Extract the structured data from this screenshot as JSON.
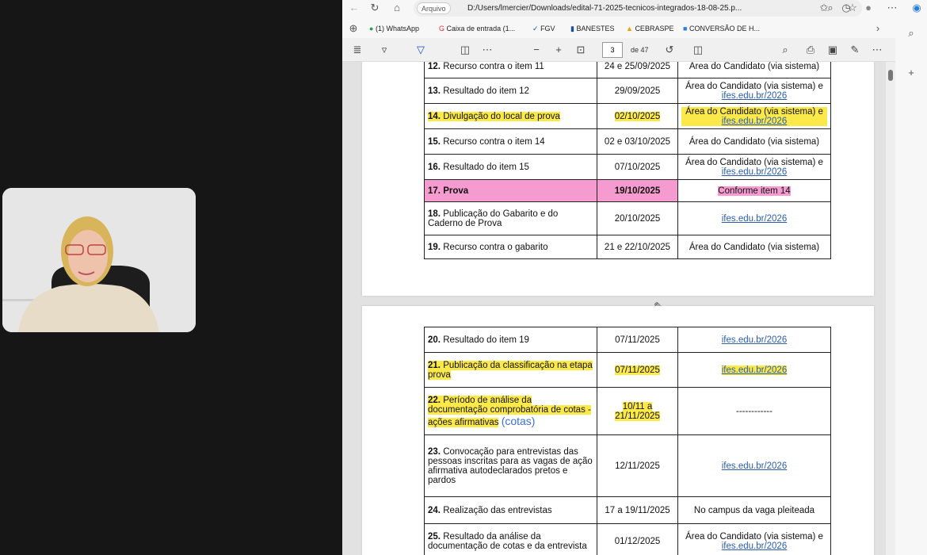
{
  "browser": {
    "address_chip": "Arquivo",
    "url": "D:/Users/lmercier/Downloads/edital-71-2025-tecnicos-integrados-18-08-25.p...",
    "bookmarks": [
      "(1) WhatsApp",
      "Caixa de entrada (1...",
      "FGV",
      "BANESTES",
      "CEBRASPE",
      "CONVERSÃO DE H..."
    ]
  },
  "pdf_toolbar": {
    "page_number": "3",
    "page_total": "de 47"
  },
  "colors": {
    "highlight_yellow": "#fbe94a",
    "highlight_pink": "#f59bd0",
    "link": "#2a5db0"
  },
  "page1_rows": [
    {
      "num": "12.",
      "item": "Recurso contra o item 11",
      "date": "24 e 25/09/2025",
      "where": "Área do Candidato (via sistema)"
    },
    {
      "num": "13.",
      "item": "Resultado do item 12",
      "date": "29/09/2025",
      "where": "Área do Candidato (via sistema) e",
      "link": "ifes.edu.br/2026"
    },
    {
      "num": "14.",
      "item": "Divulgação do local de prova",
      "date": "02/10/2025",
      "where": "Área do Candidato (via sistema) e",
      "link": "ifes.edu.br/2026"
    },
    {
      "num": "15.",
      "item": "Recurso contra o item 14",
      "date": "02 e 03/10/2025",
      "where": "Área do Candidato (via sistema)"
    },
    {
      "num": "16.",
      "item": "Resultado do item 15",
      "date": "07/10/2025",
      "where": "Área do Candidato (via sistema) e",
      "link": "ifes.edu.br/2026"
    },
    {
      "num": "17.",
      "item": "Prova",
      "date": "19/10/2025",
      "where": "Conforme item 14"
    },
    {
      "num": "18.",
      "item": "Publicação do Gabarito e do Caderno de Prova",
      "date": "20/10/2025",
      "link": "ifes.edu.br/2026"
    },
    {
      "num": "19.",
      "item": "Recurso contra o gabarito",
      "date": "21 e 22/10/2025",
      "where": "Área do Candidato (via sistema)"
    }
  ],
  "page2_rows": [
    {
      "num": "20.",
      "item": "Resultado do item 19",
      "date": "07/11/2025",
      "link": "ifes.edu.br/2026"
    },
    {
      "num": "21.",
      "item": "Publicação da classificação na etapa prova",
      "date": "07/11/2025",
      "link": "ifes.edu.br/2026"
    },
    {
      "num": "22.",
      "item": "Período de análise da documentação comprobatória de cotas - ações afirmativas",
      "annotation": "(cotas)",
      "date": "10/11 a 21/11/2025",
      "where": "------------"
    },
    {
      "num": "23.",
      "item": "Convocação para entrevistas das pessoas inscritas para as vagas de ação afirmativa autodeclarados pretos e pardos",
      "date": "12/11/2025",
      "link": "ifes.edu.br/2026"
    },
    {
      "num": "24.",
      "item": "Realização das entrevistas",
      "date": "17 a 19/11/2025",
      "where": "No campus da vaga pleiteada"
    },
    {
      "num": "25.",
      "item": "Resultado da análise da documentação de cotas e da entrevista",
      "date": "01/12/2025",
      "where": "Área do Candidato (via sistema) e",
      "link": "ifes.edu.br/2026"
    }
  ]
}
